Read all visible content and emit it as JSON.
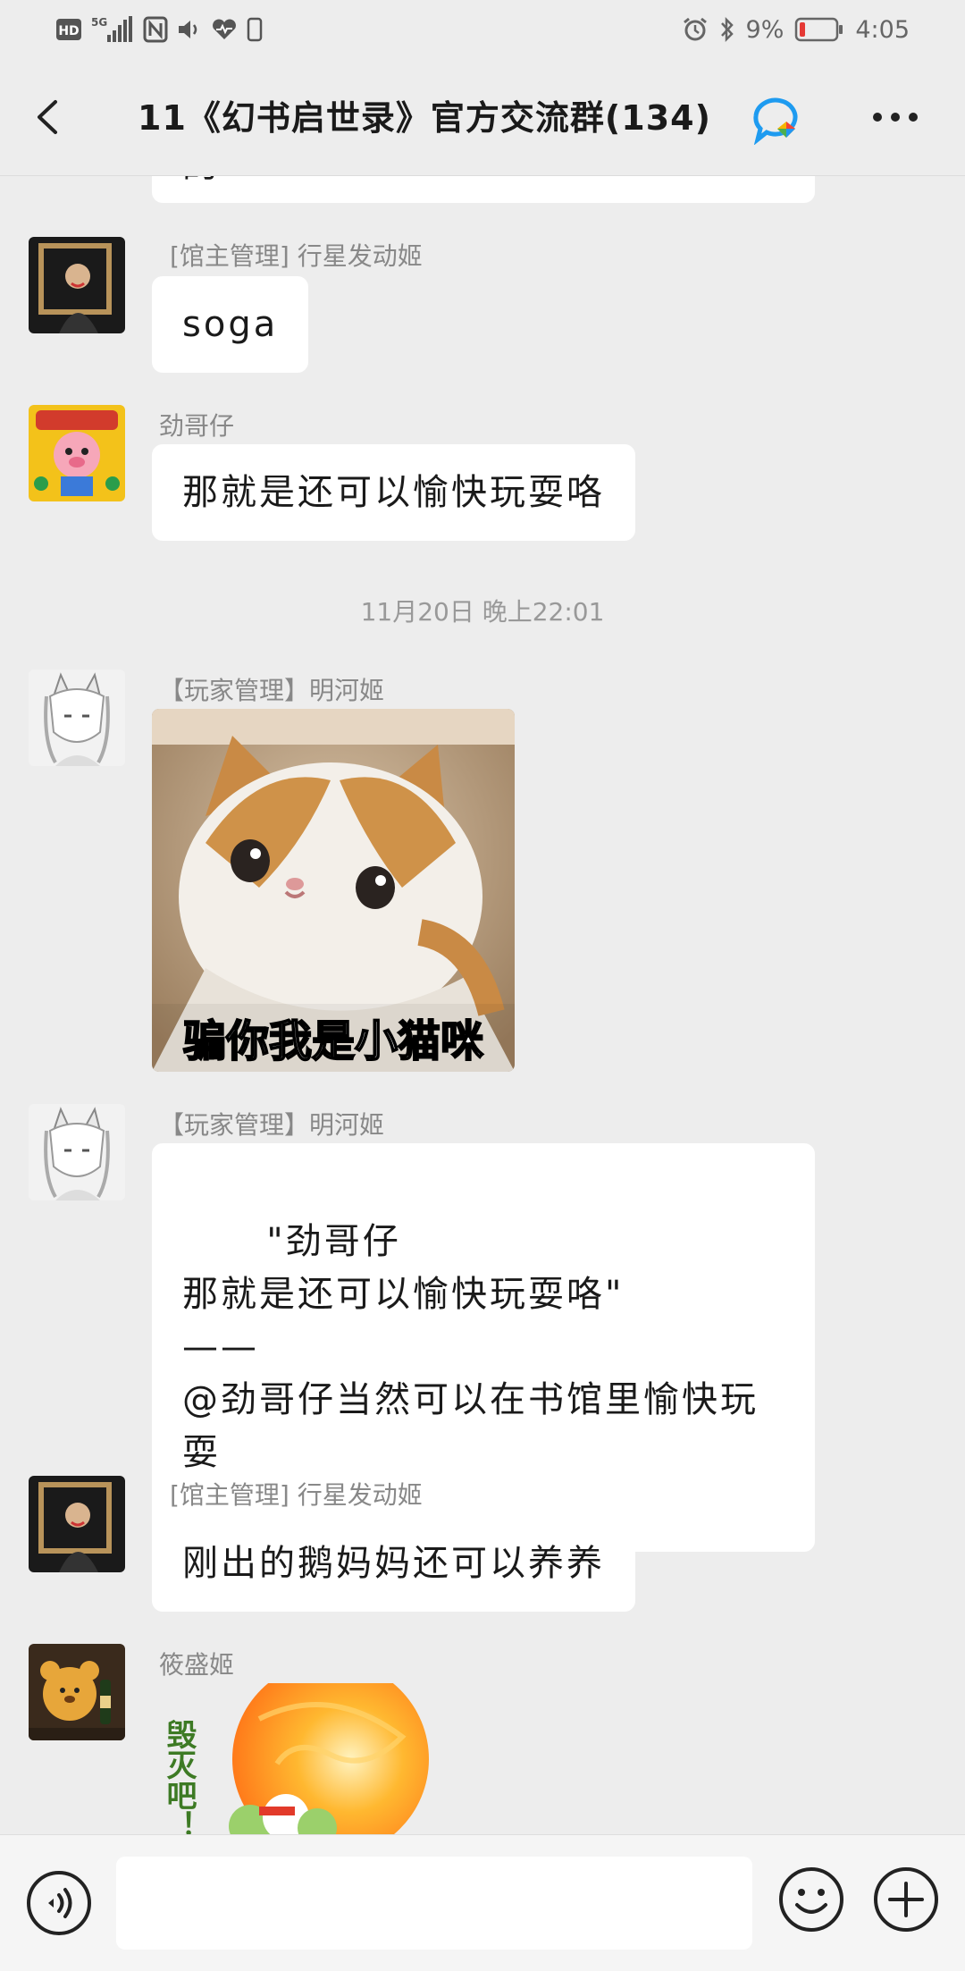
{
  "status_bar": {
    "left_icons": [
      "hd-icon",
      "5g-signal-icon",
      "nfc-icon",
      "volume-icon",
      "health-icon",
      "phone-icon"
    ],
    "hd": "HD",
    "net": "5G",
    "battery_pct": "9%",
    "time": "4:05",
    "battery_color": "#e53935"
  },
  "header": {
    "title": "11《幻书启世录》官方交流群(134)"
  },
  "chat": {
    "partial_top_text": "的",
    "messages": [
      {
        "sender": "[馆主管理] 行星发动姬",
        "text": "soga"
      },
      {
        "sender": "劲哥仔",
        "text": "那就是还可以愉快玩耍咯"
      },
      {
        "timestamp": "11月20日 晚上22:01"
      },
      {
        "sender": "【玩家管理】明河姬",
        "sticker_caption": "骗你我是小猫咪"
      },
      {
        "sender": "【玩家管理】明河姬",
        "text": "\"劲哥仔\n那就是还可以愉快玩耍咯\"\n——\n@劲哥仔当然可以在书馆里愉快玩\n耍"
      },
      {
        "sender": "[馆主管理] 行星发动姬",
        "text": "刚出的鹅妈妈还可以养养"
      },
      {
        "sender": "筱盛姬",
        "sticker_caption": "毁灭吧！"
      }
    ]
  },
  "input_bar": {
    "placeholder": "",
    "value": ""
  }
}
